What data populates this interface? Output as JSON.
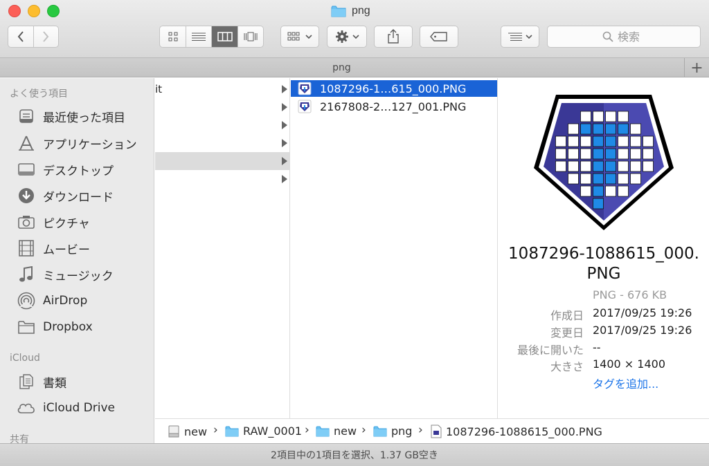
{
  "window": {
    "title": "png",
    "folder_icon": "folder-icon"
  },
  "toolbar": {
    "back_icon": "chevron-left-icon",
    "forward_icon": "chevron-right-icon",
    "view_modes": [
      "icon",
      "list",
      "column",
      "cover-flow"
    ],
    "active_view": "column",
    "search_placeholder": "検索"
  },
  "tabbar": {
    "tab_label": "png",
    "add_label": "+"
  },
  "sidebar": {
    "favorites_header": "よく使う項目",
    "favorites": [
      {
        "label": "最近使った項目",
        "icon": "recents-icon"
      },
      {
        "label": "アプリケーション",
        "icon": "applications-icon"
      },
      {
        "label": "デスクトップ",
        "icon": "desktop-icon"
      },
      {
        "label": "ダウンロード",
        "icon": "download-icon"
      },
      {
        "label": "ピクチャ",
        "icon": "camera-icon"
      },
      {
        "label": "ムービー",
        "icon": "film-icon"
      },
      {
        "label": "ミュージック",
        "icon": "music-note-icon"
      },
      {
        "label": "AirDrop",
        "icon": "airdrop-icon"
      },
      {
        "label": "Dropbox",
        "icon": "folder-icon"
      }
    ],
    "icloud_header": "iCloud",
    "icloud": [
      {
        "label": "書類",
        "icon": "documents-icon"
      },
      {
        "label": "iCloud Drive",
        "icon": "cloud-icon"
      }
    ],
    "shared_header": "共有"
  },
  "column1": {
    "rows": [
      {
        "text": "it",
        "has_arrow": true,
        "selected": false
      },
      {
        "text": "",
        "has_arrow": true,
        "selected": false
      },
      {
        "text": "",
        "has_arrow": true,
        "selected": false
      },
      {
        "text": "",
        "has_arrow": true,
        "selected": false
      },
      {
        "text": "",
        "has_arrow": true,
        "selected": true
      },
      {
        "text": "",
        "has_arrow": true,
        "selected": false
      }
    ]
  },
  "column2": {
    "files": [
      {
        "name": "1087296-1…615_000.PNG",
        "selected": true
      },
      {
        "name": "2167808-2…127_001.PNG",
        "selected": false
      }
    ]
  },
  "preview": {
    "filename": "1087296-1088615_000.PNG",
    "filename_line1": "1087296-1088615_000.",
    "filename_line2": "PNG",
    "kind_size": "PNG - 676 KB",
    "meta": [
      {
        "key": "作成日",
        "value": "2017/09/25 19:26",
        "link": false
      },
      {
        "key": "変更日",
        "value": "2017/09/25 19:26",
        "link": false
      },
      {
        "key": "最後に開いた",
        "value": "--",
        "link": false
      },
      {
        "key": "大きさ",
        "value": "1400 × 1400",
        "link": false
      },
      {
        "key": "",
        "value": "タグを追加...",
        "link": true
      }
    ]
  },
  "pathbar": {
    "items": [
      {
        "label": "new",
        "icon": "disk-icon"
      },
      {
        "label": "RAW_0001",
        "icon": "folder-icon"
      },
      {
        "label": "new",
        "icon": "folder-icon"
      },
      {
        "label": "png",
        "icon": "folder-icon"
      },
      {
        "label": "1087296-1088615_000.PNG",
        "icon": "png-file-icon"
      }
    ],
    "separator": "›"
  },
  "status": {
    "text": "2項目中の1項目を選択、1.37 GB空き"
  },
  "colors": {
    "selection": "#1a63d6",
    "badge_dark": "#3a3896",
    "badge_light": "#6b6ad6",
    "highlight_blue": "#1f8ae6"
  }
}
